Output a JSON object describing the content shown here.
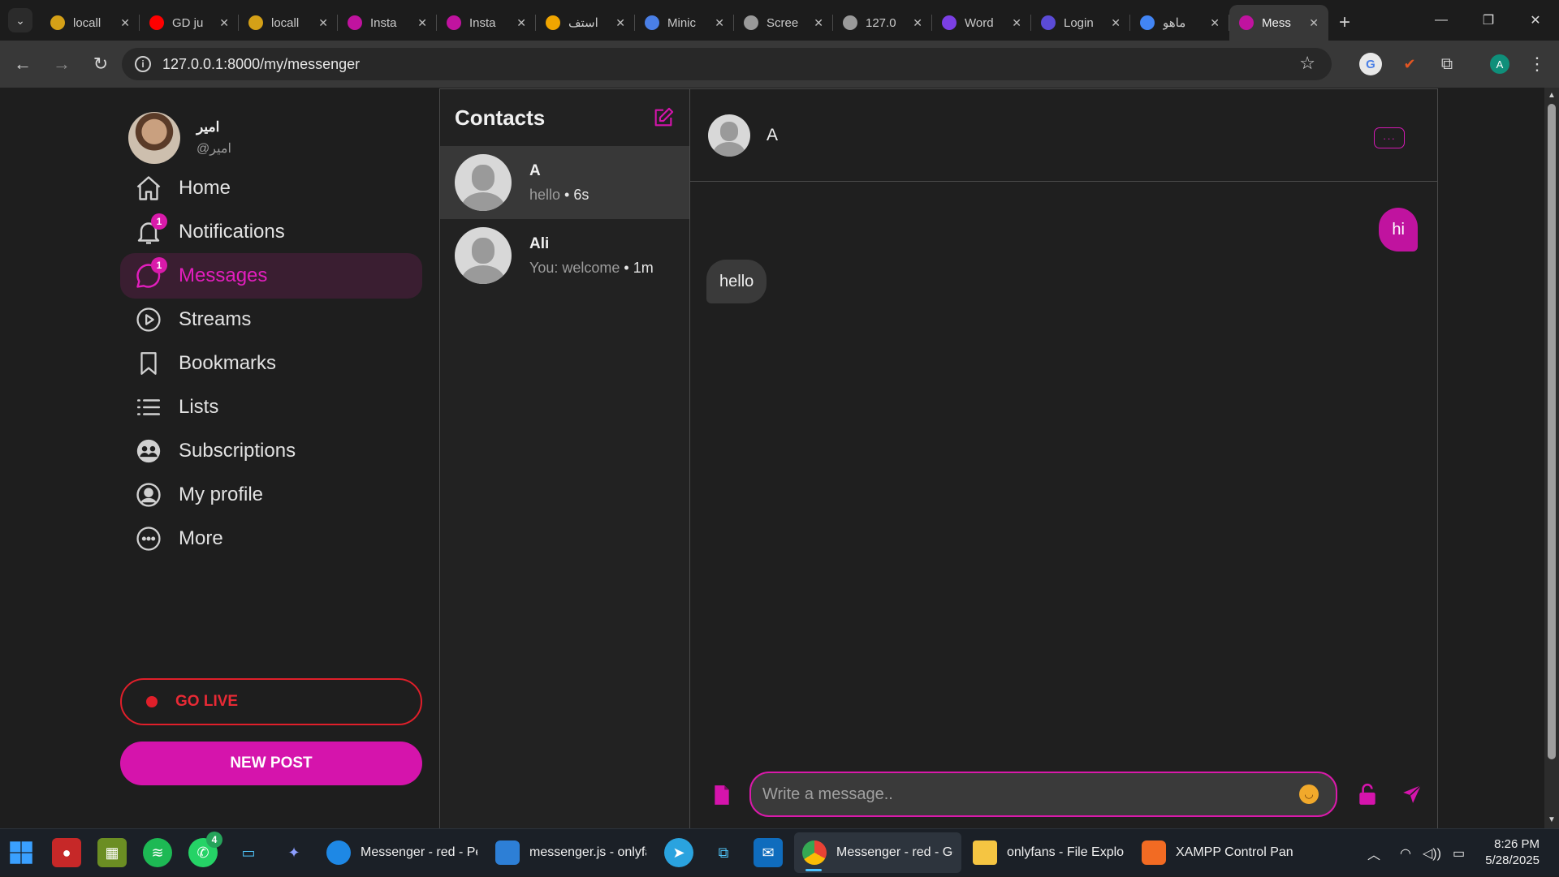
{
  "browser": {
    "tabs": [
      {
        "title": "locall",
        "favicon_color": "#d4a017"
      },
      {
        "title": "GD ju",
        "favicon_color": "#ff0000"
      },
      {
        "title": "locall",
        "favicon_color": "#d4a017"
      },
      {
        "title": "Insta",
        "favicon_color": "#c0139f"
      },
      {
        "title": "Insta",
        "favicon_color": "#c0139f"
      },
      {
        "title": "استف",
        "favicon_color": "#f0a500"
      },
      {
        "title": "Minic",
        "favicon_color": "#4a7fe6"
      },
      {
        "title": "Scree",
        "favicon_color": "#9a9a9a"
      },
      {
        "title": "127.0",
        "favicon_color": "#9a9a9a"
      },
      {
        "title": "Word",
        "favicon_color": "#7b3fe4"
      },
      {
        "title": "Login",
        "favicon_color": "#5b4bd6"
      },
      {
        "title": "ماهو",
        "favicon_color": "#4285f4"
      },
      {
        "title": "Mess",
        "favicon_color": "#c0139f"
      }
    ],
    "active_tab_index": 12,
    "url": "127.0.0.1:8000/my/messenger",
    "profile_letter": "A",
    "ext_g_letter": "G"
  },
  "app": {
    "accent": "#d514ac",
    "user": {
      "display_name": "امير",
      "handle": "@امير"
    },
    "nav": [
      {
        "label": "Home",
        "icon": "home-icon"
      },
      {
        "label": "Notifications",
        "icon": "bell-icon",
        "badge": "1"
      },
      {
        "label": "Messages",
        "icon": "chat-icon",
        "badge": "1",
        "active": true
      },
      {
        "label": "Streams",
        "icon": "play-circle-icon"
      },
      {
        "label": "Bookmarks",
        "icon": "bookmark-icon"
      },
      {
        "label": "Lists",
        "icon": "list-icon"
      },
      {
        "label": "Subscriptions",
        "icon": "subscriptions-icon"
      },
      {
        "label": "My profile",
        "icon": "user-circle-icon"
      },
      {
        "label": "More",
        "icon": "more-circle-icon"
      }
    ],
    "go_live_label": "GO LIVE",
    "new_post_label": "NEW POST"
  },
  "contacts": {
    "title": "Contacts",
    "items": [
      {
        "name": "A",
        "preview": "hello",
        "time": "6s",
        "active": true
      },
      {
        "name": "Ali",
        "preview": "You: welcome",
        "time": "1m",
        "active": false
      }
    ]
  },
  "chat": {
    "contact_name": "A",
    "more_label": "···",
    "messages": [
      {
        "direction": "out",
        "text": "hi"
      },
      {
        "direction": "in",
        "text": "hello"
      }
    ],
    "input_placeholder": "Write a message..",
    "input_value": ""
  },
  "taskbar": {
    "apps": [
      {
        "label": "Messenger - red - Per",
        "color": "#1e88e5"
      },
      {
        "label": "messenger.js - onlyfar",
        "color": "#2d7fd6"
      },
      {
        "label": "Messenger - red - Goo",
        "color": "#e94235",
        "active": true
      },
      {
        "label": "onlyfans - File Explor",
        "color": "#f5c542"
      },
      {
        "label": "XAMPP Control Panel",
        "color": "#f26b23"
      }
    ],
    "whatsapp_badge": "4",
    "time": "8:26 PM",
    "date": "5/28/2025"
  }
}
